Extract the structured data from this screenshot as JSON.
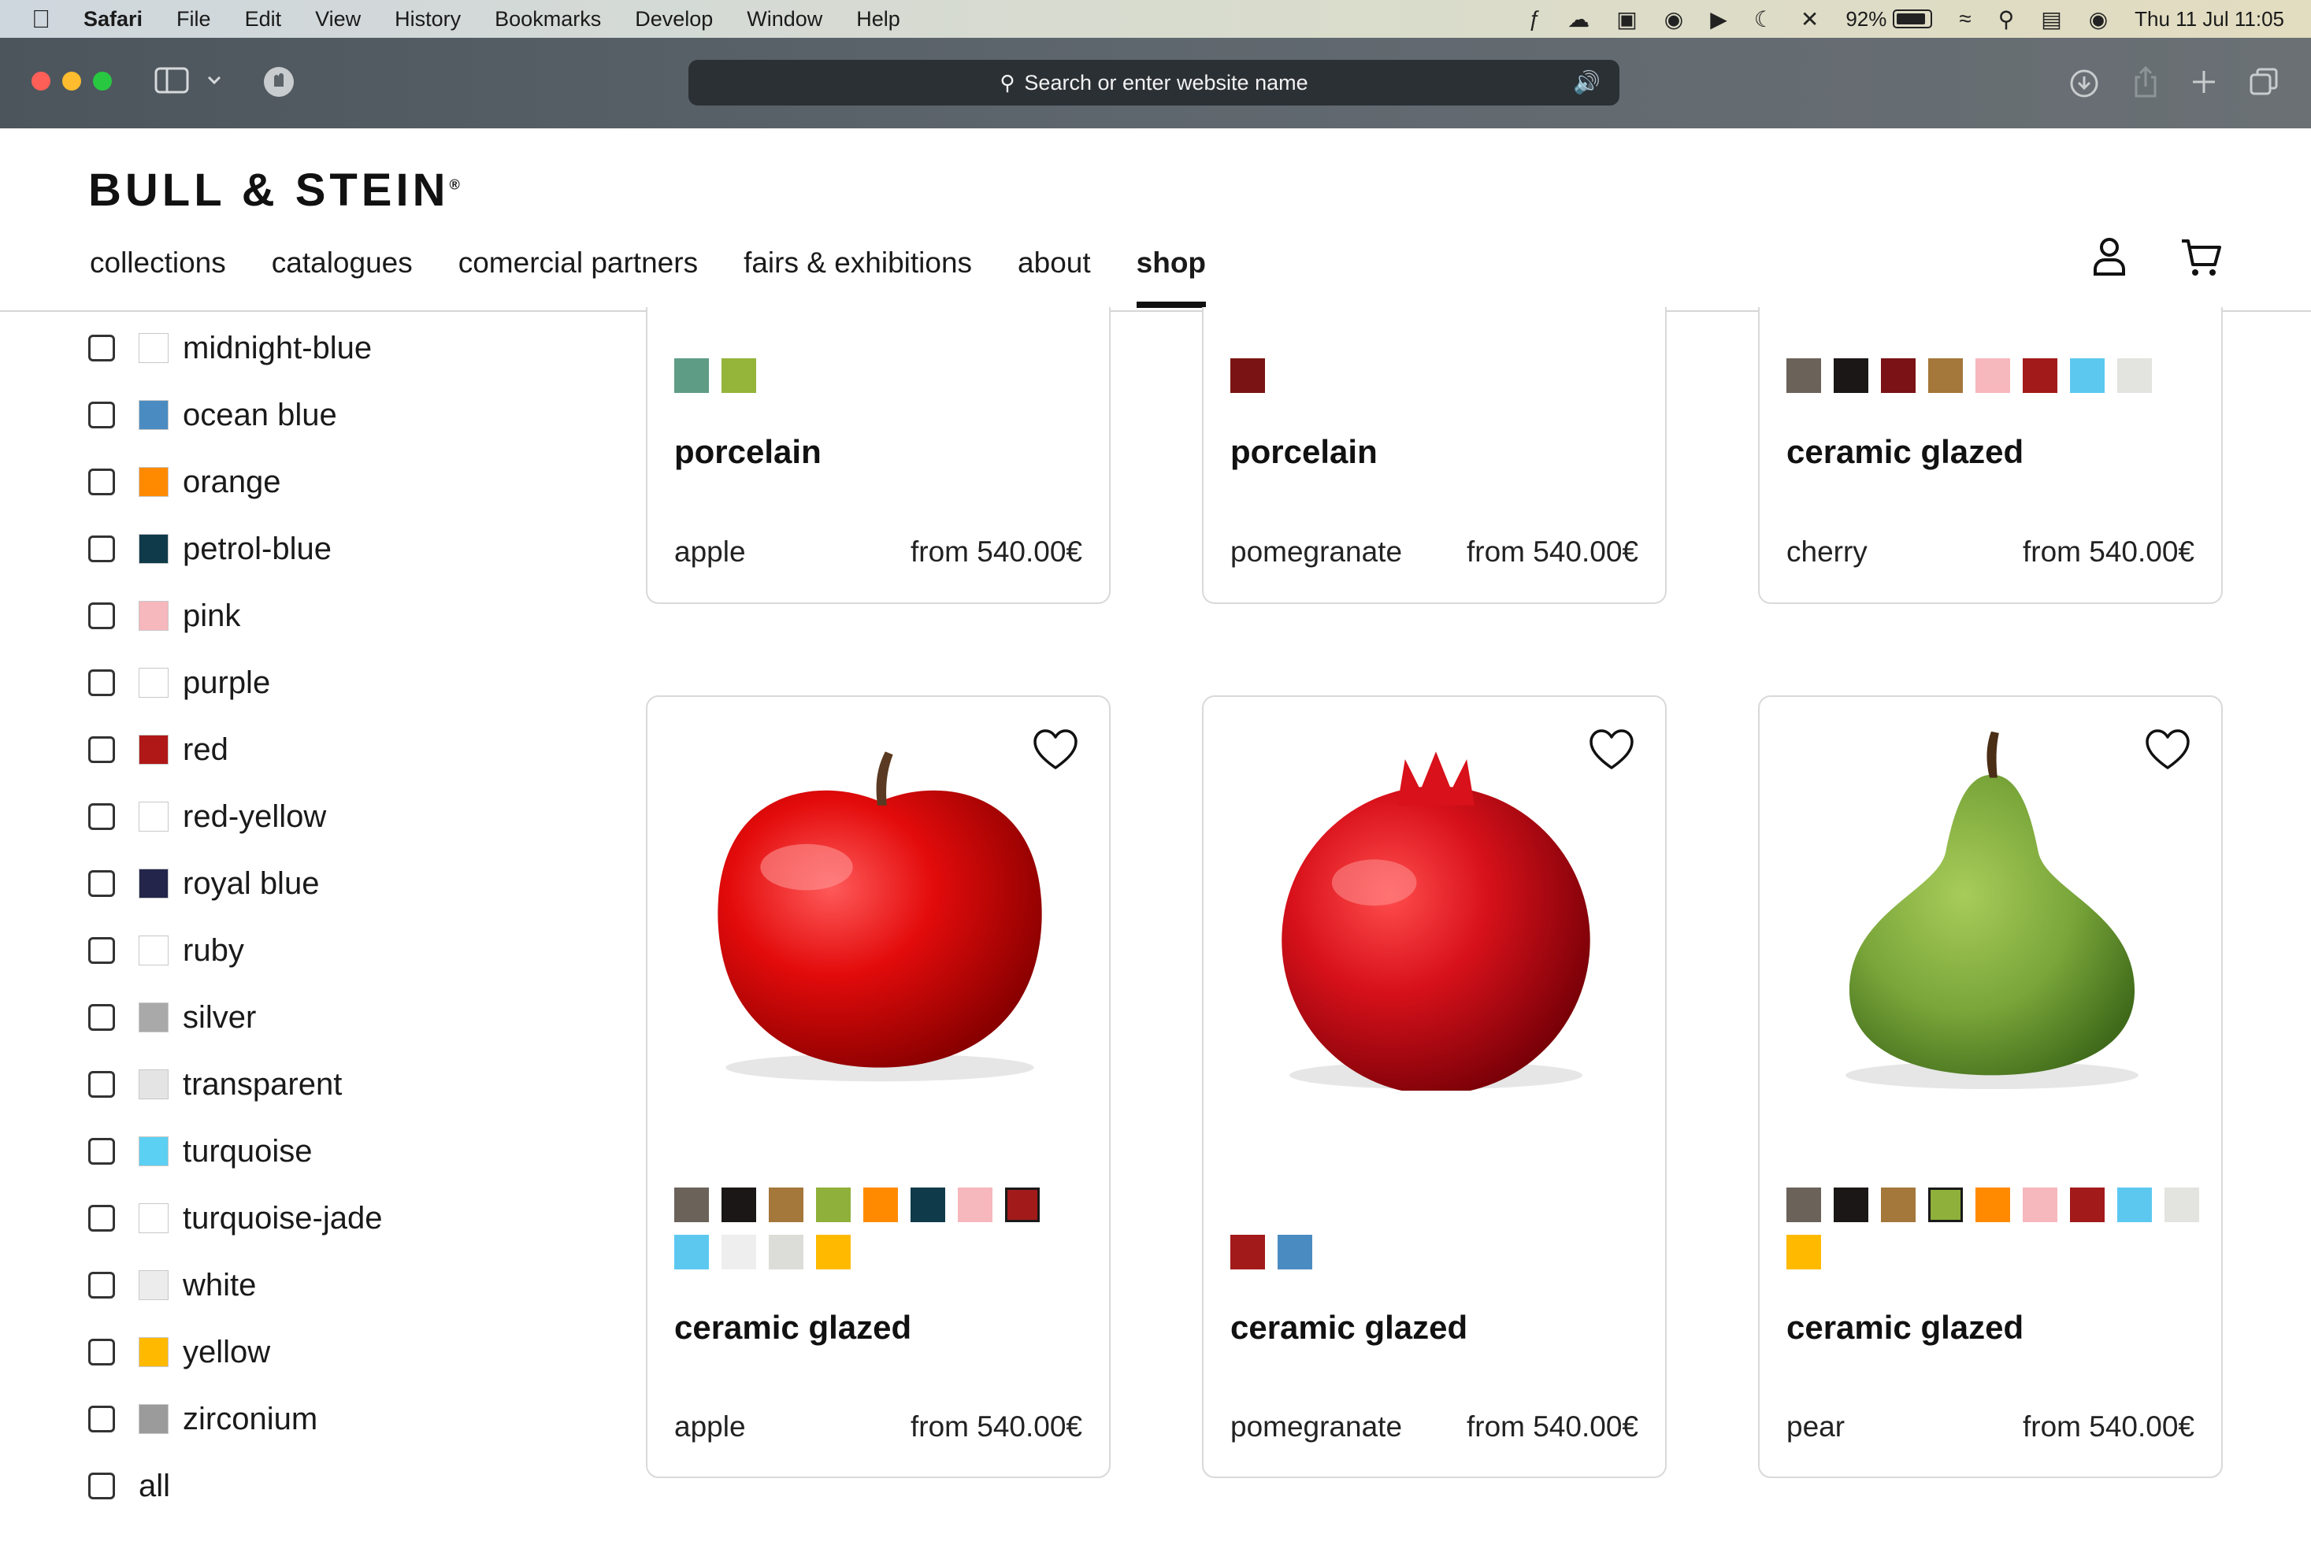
{
  "menubar": {
    "app": "Safari",
    "items": [
      "File",
      "Edit",
      "View",
      "History",
      "Bookmarks",
      "Develop",
      "Window",
      "Help"
    ],
    "battery": "92%",
    "datetime": "Thu 11 Jul  11:05"
  },
  "browser": {
    "address_placeholder": "Search or enter website name"
  },
  "site": {
    "logo": "BULL & STEIN",
    "logo_mark": "®",
    "nav": [
      "collections",
      "catalogues",
      "comercial partners",
      "fairs & exhibitions",
      "about",
      "shop"
    ],
    "active_nav": "shop"
  },
  "filters": [
    {
      "label": "midnight-blue",
      "swatch": "#ffffff"
    },
    {
      "label": "ocean blue",
      "swatch": "#4a8cc2"
    },
    {
      "label": "orange",
      "swatch": "#ff8a00"
    },
    {
      "label": "petrol-blue",
      "swatch": "#0f3a4a"
    },
    {
      "label": "pink",
      "swatch": "#f6b7bd"
    },
    {
      "label": "purple",
      "swatch": "#ffffff"
    },
    {
      "label": "red",
      "swatch": "#b01818"
    },
    {
      "label": "red-yellow",
      "swatch": "#ffffff"
    },
    {
      "label": "royal blue",
      "swatch": "#23264a"
    },
    {
      "label": "ruby",
      "swatch": "#ffffff"
    },
    {
      "label": "silver",
      "swatch": "#a9a9a9"
    },
    {
      "label": "transparent",
      "swatch": "#e4e4e4"
    },
    {
      "label": "turquoise",
      "swatch": "#5cd0f2"
    },
    {
      "label": "turquoise-jade",
      "swatch": "#ffffff"
    },
    {
      "label": "white",
      "swatch": "#ececec"
    },
    {
      "label": "yellow",
      "swatch": "#ffba00"
    },
    {
      "label": "zirconium",
      "swatch": "#9b9b9b"
    },
    {
      "label": "all",
      "swatch": ""
    }
  ],
  "products_top": [
    {
      "title": "porcelain",
      "name": "apple",
      "price": "from 540.00€",
      "swatches": [
        "#5f9c86",
        "#94b43a"
      ]
    },
    {
      "title": "porcelain",
      "name": "pomegranate",
      "price": "from 540.00€",
      "swatches": [
        "#7a1414"
      ]
    },
    {
      "title": "ceramic glazed",
      "name": "cherry",
      "price": "from 540.00€",
      "swatches": [
        "#6b625a",
        "#1b1716",
        "#7a1216",
        "#a4773a",
        "#f6b7bd",
        "#a31a1a",
        "#5cc8f0",
        "#e3e3df"
      ]
    }
  ],
  "products_bottom": [
    {
      "title": "ceramic glazed",
      "name": "apple",
      "price": "from 540.00€",
      "fruit": "apple",
      "selected": 7,
      "swatches": [
        "#6b625a",
        "#1b1716",
        "#a4773a",
        "#8fb03a",
        "#ff8a00",
        "#0f3a4a",
        "#f6b7bd",
        "#a31a1a",
        "#ffffff",
        "#5cc8f0",
        "#eeeeee",
        "#dcdcd8",
        "#ffba00"
      ]
    },
    {
      "title": "ceramic glazed",
      "name": "pomegranate",
      "price": "from 540.00€",
      "fruit": "pomegranate",
      "selected": -1,
      "swatches": [
        "#a31a1a",
        "#4a8cc2"
      ]
    },
    {
      "title": "ceramic glazed",
      "name": "pear",
      "price": "from 540.00€",
      "fruit": "pear",
      "selected": 3,
      "swatches": [
        "#6b625a",
        "#1b1716",
        "#a4773a",
        "#8fb03a",
        "#ff8a00",
        "#f6b7bd",
        "#a31a1a",
        "#5cc8f0",
        "#e3e3df",
        "#ffba00"
      ]
    }
  ]
}
